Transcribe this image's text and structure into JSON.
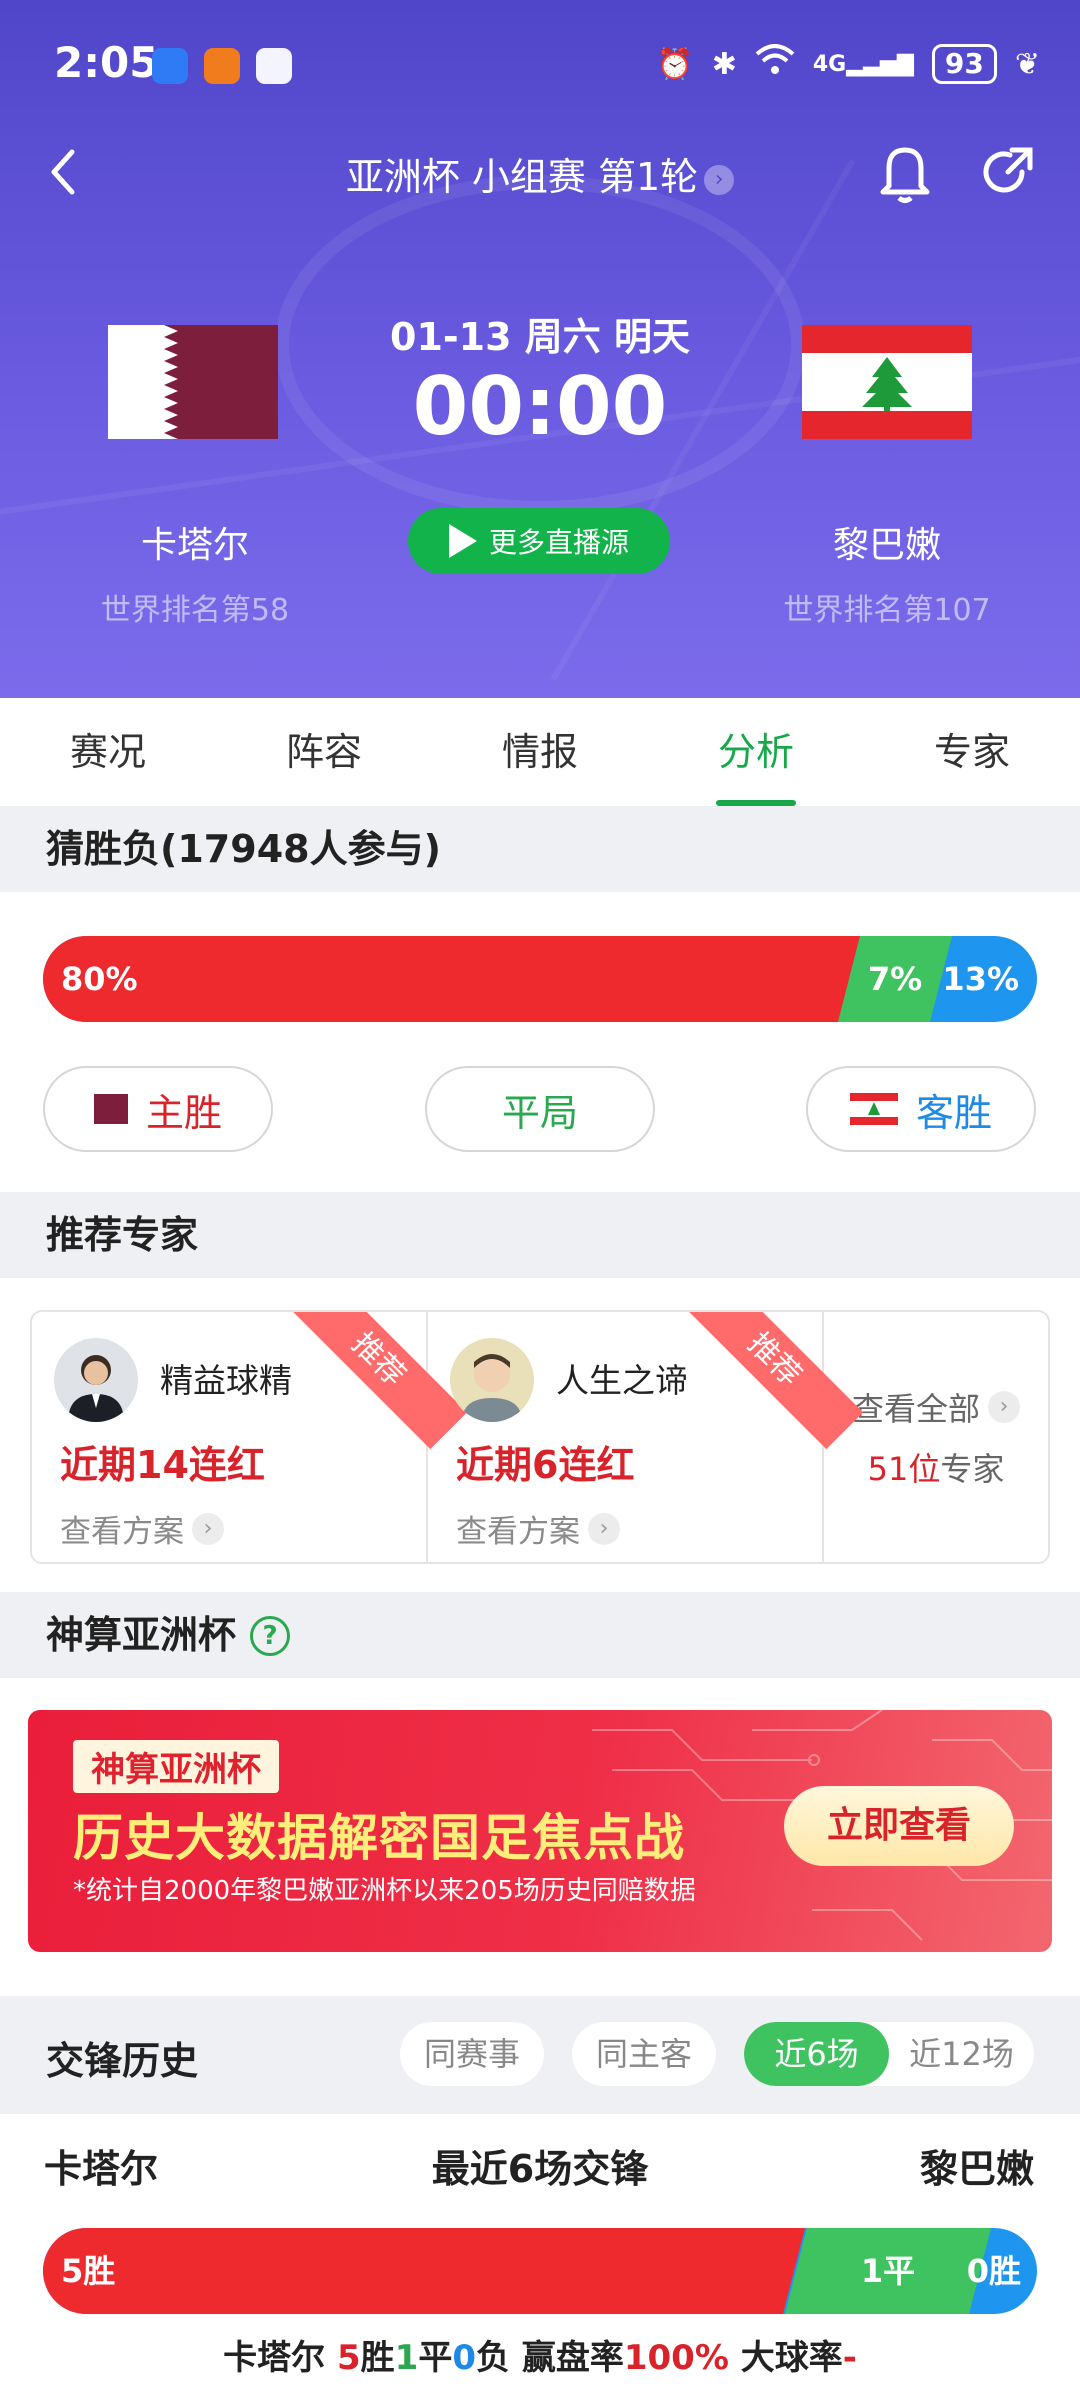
{
  "status": {
    "time": "2:05",
    "battery": "93",
    "network": "4G"
  },
  "nav": {
    "title": "亚洲杯 小组赛 第1轮"
  },
  "match": {
    "date": "01-13 周六 明天",
    "time": "00:00",
    "home": {
      "name": "卡塔尔",
      "rank": "世界排名第58"
    },
    "away": {
      "name": "黎巴嫩",
      "rank": "世界排名第107"
    },
    "live_button": "更多直播源"
  },
  "tabs": [
    "赛况",
    "阵容",
    "情报",
    "分析",
    "专家"
  ],
  "active_tab": "分析",
  "vote": {
    "header": "猜胜负(17948人参与)",
    "home_pct": "80%",
    "draw_pct": "7%",
    "away_pct": "13%",
    "home_share": 0.8,
    "draw_share": 0.07,
    "away_share": 0.13,
    "home_label": "主胜",
    "draw_label": "平局",
    "away_label": "客胜"
  },
  "experts": {
    "header": "推荐专家",
    "items": [
      {
        "name": "精益球精",
        "streak": "近期14连红",
        "link": "查看方案",
        "ribbon": "推荐"
      },
      {
        "name": "人生之谛",
        "streak": "近期6连红",
        "link": "查看方案",
        "ribbon": "推荐"
      }
    ],
    "view_all": "查看全部",
    "count_num": "51位",
    "count_suffix": "专家"
  },
  "promo": {
    "header": "神算亚洲杯",
    "tag": "神算亚洲杯",
    "title": "历史大数据解密国足焦点战",
    "subtitle": "*统计自2000年黎巴嫩亚洲杯以来205场历史同赔数据",
    "button": "立即查看"
  },
  "history": {
    "header": "交锋历史",
    "filters": [
      "同赛事",
      "同主客"
    ],
    "range_options": [
      "近6场",
      "近12场"
    ],
    "active_range": "近6场",
    "home": "卡塔尔",
    "middle": "最近6场交锋",
    "away": "黎巴嫩",
    "win_label": "5胜",
    "draw_label": "1平",
    "loss_label": "0胜",
    "summary": {
      "team": "卡塔尔",
      "wins": "5",
      "win_word": "胜",
      "draws": "1",
      "draw_word": "平",
      "losses": "0",
      "loss_word": "负",
      "handicap_label": "赢盘率",
      "handicap_value": "100%",
      "over_label": "大球率",
      "over_value": "-"
    }
  },
  "colors": {
    "header_bg": "#5046c9",
    "accent_green": "#18a84a",
    "home_red": "#ee2a2e",
    "draw_green": "#3fc260",
    "away_blue": "#1e96f0"
  }
}
